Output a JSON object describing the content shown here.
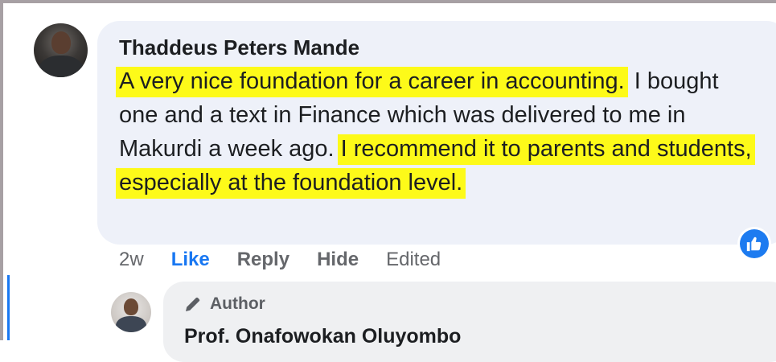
{
  "comment": {
    "author": "Thaddeus Peters Mande",
    "text_segments": [
      {
        "text": "A very nice foundation for a career in accounting.",
        "highlighted": true
      },
      {
        "text": " I bought one and a text in Finance which was delivered to me in Makurdi a week ago. ",
        "highlighted": false
      },
      {
        "text": "I recommend it to parents and students, especially at the foundation level.",
        "highlighted": true
      }
    ],
    "time": "2w",
    "like_label": "Like",
    "reply_label": "Reply",
    "hide_label": "Hide",
    "edited_label": "Edited",
    "reaction_icon": "thumbs-up-icon"
  },
  "reply": {
    "badge_label": "Author",
    "badge_icon": "pen-icon",
    "author": "Prof. Onafowokan Oluyombo"
  },
  "colors": {
    "highlight": "#fdfa19",
    "like_blue": "#1877f2",
    "bubble": "#eef1f9",
    "reply_bubble": "#eff0f2"
  }
}
